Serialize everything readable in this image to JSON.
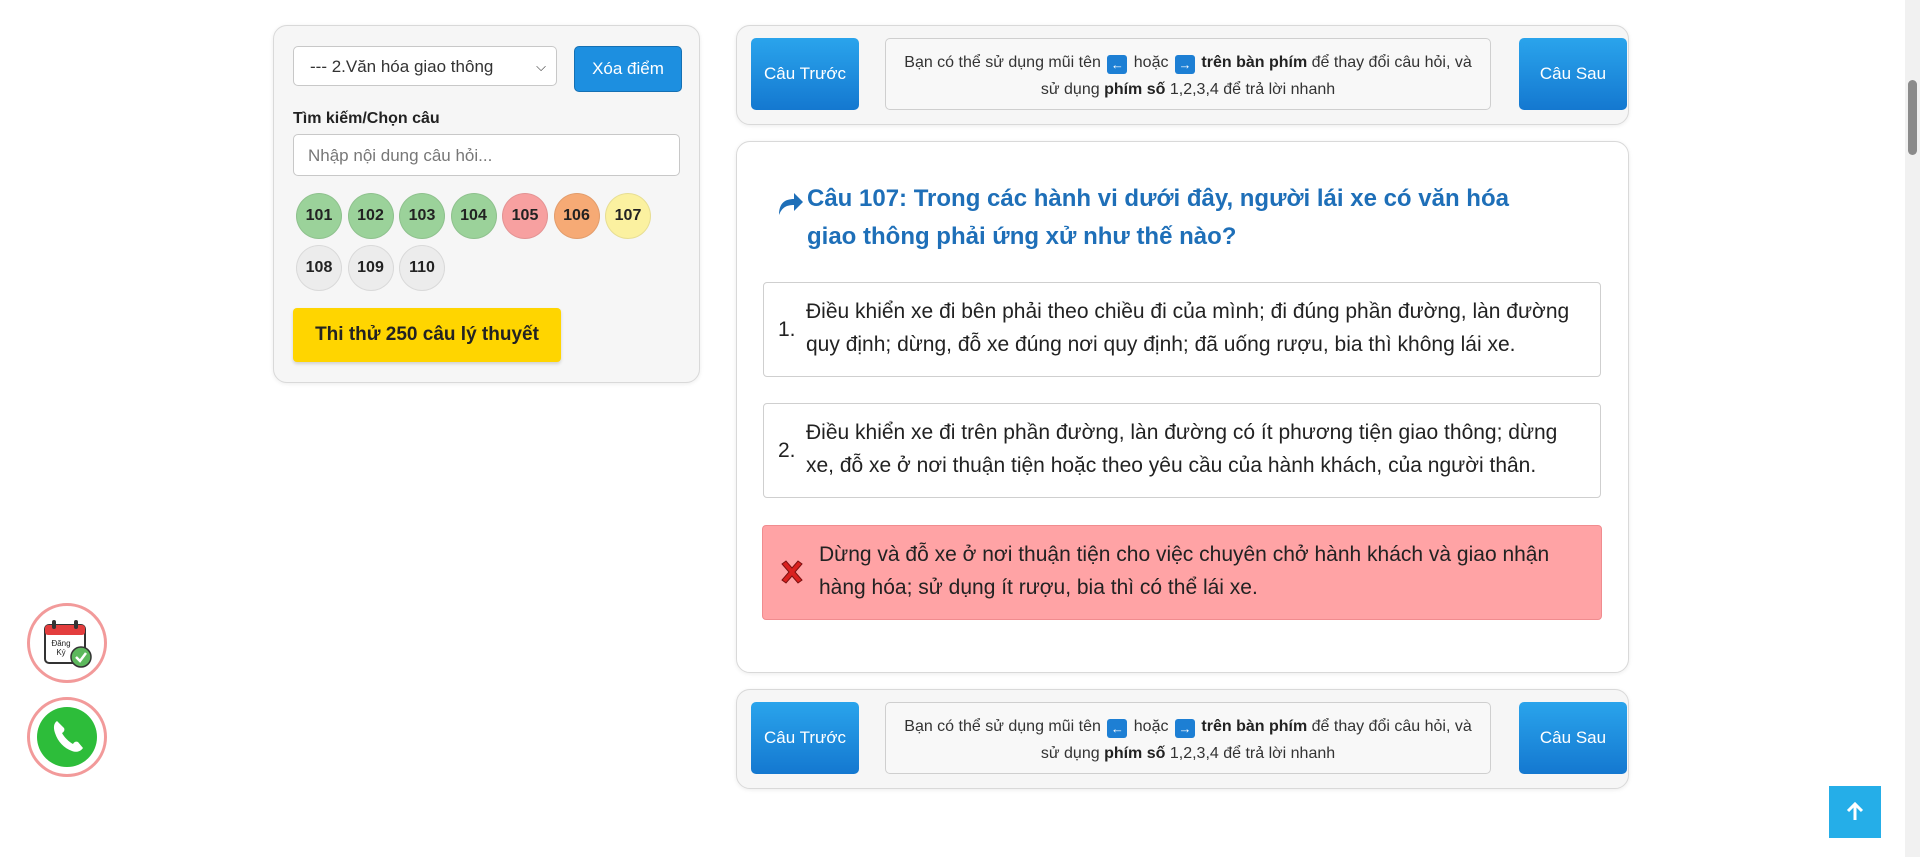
{
  "left_panel": {
    "category_select": "--- 2.Văn hóa giao thông",
    "clear_button": "Xóa điểm",
    "search_label": "Tìm kiếm/Chọn câu",
    "search_placeholder": "Nhập nội dung câu hỏi...",
    "question_bubbles": [
      {
        "num": "101",
        "color": "#9bd29a"
      },
      {
        "num": "102",
        "color": "#9bd29a"
      },
      {
        "num": "103",
        "color": "#9bd29a"
      },
      {
        "num": "104",
        "color": "#9bd29a"
      },
      {
        "num": "105",
        "color": "#f7a0a0"
      },
      {
        "num": "106",
        "color": "#f6aa75"
      },
      {
        "num": "107",
        "color": "#fbf1a0"
      },
      {
        "num": "108",
        "color": "#ececec"
      },
      {
        "num": "109",
        "color": "#ececec"
      },
      {
        "num": "110",
        "color": "#ececec"
      }
    ],
    "test_button": "Thi thử 250 câu lý thuyết"
  },
  "nav": {
    "prev": "Câu Trước",
    "next": "Câu Sau",
    "hint_part1": "Bạn có thể sử dụng mũi tên",
    "hint_or": "hoặc",
    "hint_keyboard": "trên bàn phím",
    "hint_part2": "để thay đổi câu hỏi, và sử dụng",
    "hint_numkeys": "phím số",
    "hint_part3": "1,2,3,4 để trả lời nhanh",
    "key_left": "←",
    "key_right": "→"
  },
  "question": {
    "title": "Câu 107: Trong các hành vi dưới đây, người lái xe có văn hóa giao thông phải ứng xử như thế nào?",
    "answers": [
      {
        "num": "1.",
        "text": "Điều khiển xe đi bên phải theo chiều đi của mình; đi đúng phần đường, làn đường quy định; dừng, đỗ xe đúng nơi quy định; đã uống rượu, bia thì không lái xe."
      },
      {
        "num": "2.",
        "text": "Điều khiển xe đi trên phần đường, làn đường có ít phương tiện giao thông; dừng xe, đỗ xe ở nơi thuận tiện hoặc theo yêu cầu của hành khách, của người thân."
      },
      {
        "num": "",
        "text": "Dừng và đỗ xe ở nơi thuận tiện cho việc chuyên chở hành khách và giao nhận hàng hóa; sử dụng ít rượu, bia thì có thể lái xe.",
        "status": "wrong"
      }
    ]
  },
  "floating": {
    "register_icon_text_line1": "Đăng",
    "register_icon_text_line2": "Ký"
  }
}
